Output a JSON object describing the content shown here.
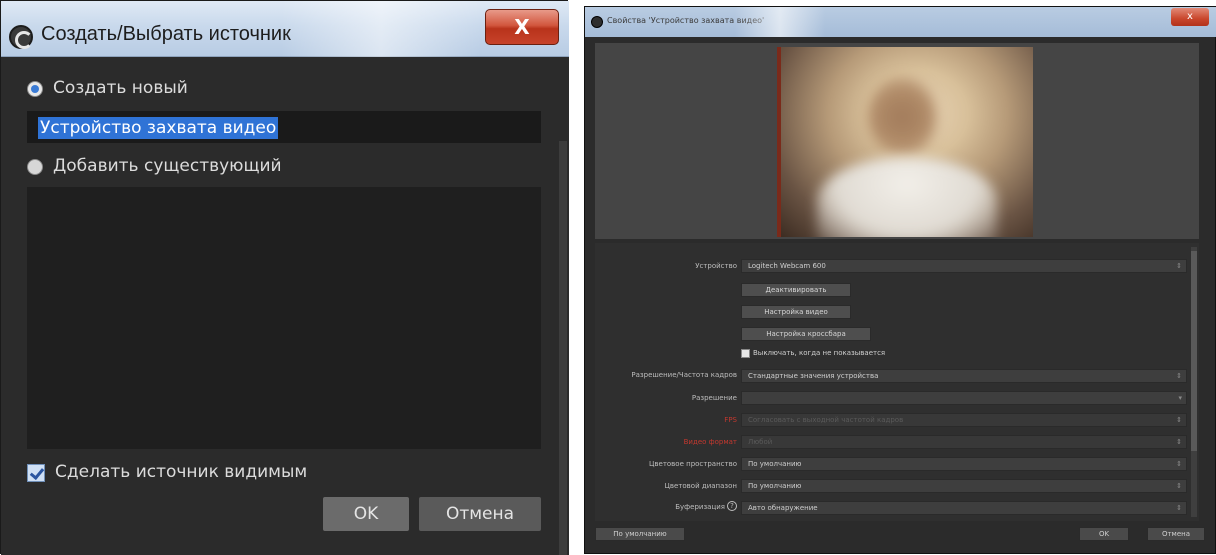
{
  "create_dialog": {
    "title": "Создать/Выбрать источник",
    "close_symbol": "X",
    "create_new_label": "Создать новый",
    "name_value": "Устройство захвата видео",
    "add_existing_label": "Добавить существующий",
    "make_visible_label": "Сделать источник видимым",
    "make_visible_checked": true,
    "ok_label": "OK",
    "cancel_label": "Отмена"
  },
  "properties_dialog": {
    "title": "Свойства 'Устройство захвата видео'",
    "close_symbol": "x",
    "device_label": "Устройство",
    "device_value": "Logitech Webcam 600",
    "deactivate_button": "Деактивировать",
    "video_settings_button": "Настройка видео",
    "crossbar_settings_button": "Настройка кроссбара",
    "disable_hidden_label": "Выключать, когда не показывается",
    "disable_hidden_checked": true,
    "res_fps_label": "Разрешение/Частота кадров",
    "res_fps_value": "Стандартные значения устройства",
    "resolution_label": "Разрешение",
    "resolution_value": "",
    "fps_label": "FPS",
    "fps_value": "Согласовать с выходной частотой кадров",
    "video_format_label": "Видео формат",
    "video_format_value": "Любой",
    "color_space_label": "Цветовое пространство",
    "color_space_value": "По умолчанию",
    "color_range_label": "Цветовой диапазон",
    "color_range_value": "По умолчанию",
    "buffering_label": "Буферизация",
    "buffering_value": "Авто обнаружение",
    "defaults_button": "По умолчанию",
    "ok_button": "OK",
    "cancel_button": "Отмена",
    "arrow_glyph": "⇕",
    "down_glyph": "▾",
    "help_glyph": "?"
  }
}
